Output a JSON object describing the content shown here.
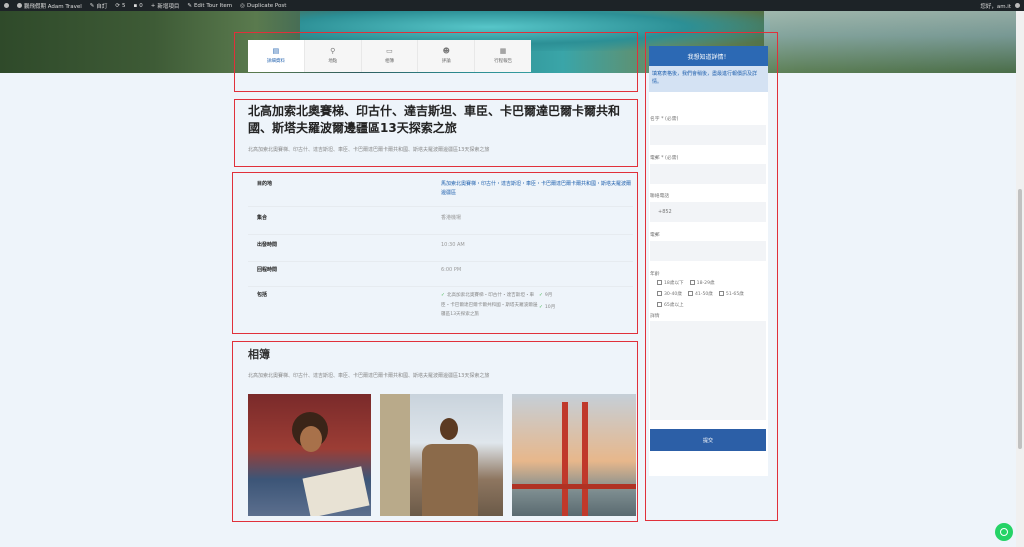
{
  "adminbar": {
    "site": "鵬飛假期 Adam Travel",
    "customize": "自訂",
    "updates": "5",
    "comments": "0",
    "new": "新增項目",
    "edit": "Edit Tour Item",
    "duplicate": "Duplicate Post",
    "greeting": "您好，am.it"
  },
  "tabs": [
    {
      "label": "詳細資料",
      "icon": "document-icon"
    },
    {
      "label": "地點",
      "icon": "map-pin-icon"
    },
    {
      "label": "相簿",
      "icon": "camera-icon"
    },
    {
      "label": "評論",
      "icon": "users-icon"
    },
    {
      "label": "行程報告",
      "icon": "calendar-icon"
    }
  ],
  "tour": {
    "title": "北高加索北奧賽梯、印古什、達吉斯坦、車臣、卡巴爾達巴爾卡爾共和國、斯塔夫羅波爾邊疆區13天探索之旅",
    "subtitle": "北高加索北奧賽梯、印古什、達吉斯坦、車臣、卡巴爾達巴爾卡爾共和國、斯塔夫羅波爾邊疆區13天探索之旅"
  },
  "info": {
    "destination_label": "目的地",
    "destination_value": "馬加索北奧賽梯・印古什・達吉斯坦・車臣・卡巴爾達巴爾卡爾共和國・斯塔夫羅波爾邊疆區",
    "meeting_label": "集合",
    "meeting_value": "香港機場",
    "departure_label": "出發時間",
    "departure_value": "10:30 AM",
    "return_label": "回程時間",
    "return_value": "6:00 PM",
    "includes_label": "包括",
    "includes_1": "北高加索北奧賽梯・印古什・達吉斯坦・車臣・卡巴爾達巴爾卡爾共和國・斯塔夫羅波爾邊疆區13天探索之旅",
    "includes_2": "9月",
    "includes_3": "10月"
  },
  "gallery": {
    "title": "相簿",
    "subtitle": "北高加索北奧賽梯、印古什、達吉斯坦、車臣、卡巴爾達巴爾卡爾共和國、斯塔夫羅波爾邊疆區13天探索之旅"
  },
  "form": {
    "header": "我想知道詳情！",
    "intro": "填寫表格後，我們會稍後，盡最進行報價訊及詳情。",
    "name_label": "名字 * (必需)",
    "email_label": "電郵 * (必需)",
    "phone_label": "聯絡電話",
    "phone_value": "+852",
    "mobile_label": "電郵",
    "age_label": "年齡",
    "ages": [
      "18歲以下",
      "18-29歲",
      "30-40歲",
      "41-50歲",
      "51-65歲",
      "65歲以上"
    ],
    "details_label": "詳情",
    "submit": "提交"
  }
}
